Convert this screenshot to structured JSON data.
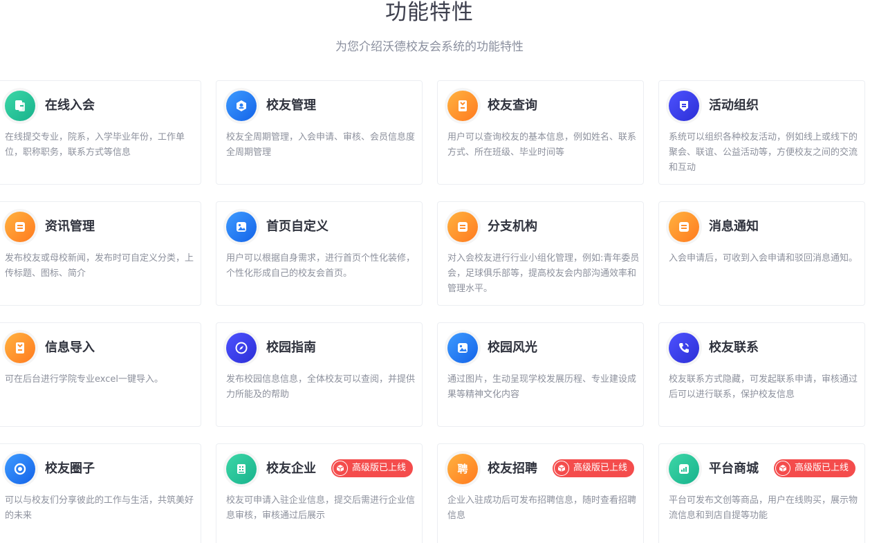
{
  "header": {
    "title": "功能特性",
    "subtitle": "为您介绍沃德校友会系统的功能特性"
  },
  "badge_label": "高级版已上线",
  "colors": {
    "badge": "#f44c4c",
    "title": "#2f323d",
    "desc": "#8c909c"
  },
  "features": [
    {
      "title": "在线入会",
      "desc": "在线提交专业，院系，入学毕业年份，工作单位，职称职务，联系方式等信息",
      "icon": "join-icon"
    },
    {
      "title": "校友管理",
      "desc": "校友全周期管理，入会申请、审核、会员信息度全周期管理",
      "icon": "manage-icon"
    },
    {
      "title": "校友查询",
      "desc": "用户可以查询校友的基本信息，例如姓名、联系方式、所在班级、毕业时间等",
      "icon": "query-icon"
    },
    {
      "title": "活动组织",
      "desc": "系统可以组织各种校友活动，例如线上或线下的聚会、联谊、公益活动等，方便校友之间的交流和互动",
      "icon": "activity-icon"
    },
    {
      "title": "资讯管理",
      "desc": "发布校友或母校新闻，发布时可自定义分类，上传标题、图标、简介",
      "icon": "news-icon"
    },
    {
      "title": "首页自定义",
      "desc": "用户可以根据自身需求，进行首页个性化装修，个性化形成自己的校友会首页。",
      "icon": "image-icon"
    },
    {
      "title": "分支机构",
      "desc": "对入会校友进行行业小组化管理，例如:青年委员会，足球俱乐部等，提高校友会内部沟通效率和管理水平。",
      "icon": "branch-icon"
    },
    {
      "title": "消息通知",
      "desc": "入会申请后，可收到入会申请和驳回消息通知。",
      "icon": "message-icon"
    },
    {
      "title": "信息导入",
      "desc": "可在后台进行学院专业excel一键导入。",
      "icon": "import-icon"
    },
    {
      "title": "校园指南",
      "desc": "发布校园信息信息，全体校友可以查阅，并提供力所能及的帮助",
      "icon": "compass-icon"
    },
    {
      "title": "校园风光",
      "desc": "通过图片，生动呈现学校发展历程、专业建设成果等精神文化内容",
      "icon": "photo-icon"
    },
    {
      "title": "校友联系",
      "desc": "校友联系方式隐藏，可发起联系申请，审核通过后可以进行联系，保护校友信息",
      "icon": "phone-icon"
    },
    {
      "title": "校友圈子",
      "desc": "可以与校友们分享彼此的工作与生活，共筑美好的未来",
      "icon": "circle-icon"
    },
    {
      "title": "校友企业",
      "desc": "校友可申请入驻企业信息，提交后需进行企业信息审核，审核通过后展示",
      "icon": "enterprise-icon"
    },
    {
      "title": "校友招聘",
      "desc": "企业入驻成功后可发布招聘信息，随时查看招聘信息",
      "icon": "recruit-icon"
    },
    {
      "title": "平台商城",
      "desc": "平台可发布文创等商品，用户在线购买，展示物流信息和到店自提等功能",
      "icon": "mall-icon"
    }
  ]
}
